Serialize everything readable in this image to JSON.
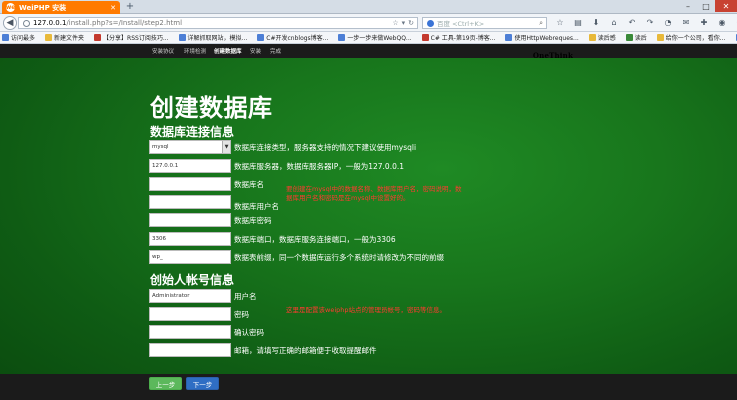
{
  "browser": {
    "tab_title": "WeiPHP 安装",
    "tab_logo": "we",
    "new_tab": "+",
    "window_controls": {
      "minimize": "–",
      "maximize": "□",
      "close": "✕"
    },
    "url_host": "127.0.0.1",
    "url_path": "/install.php?s=/Install/step2.html",
    "search_placeholder": "百度 <Ctrl+K>"
  },
  "bookmarks": [
    {
      "label": "访问最多",
      "color": "#4d7fd6"
    },
    {
      "label": "新建文件夹",
      "color": "#e8b93a"
    },
    {
      "label": "【分享】RSS订阅技巧...",
      "color": "#c43a2f"
    },
    {
      "label": "详解抓取网站，模拟...",
      "color": "#4d7fd6"
    },
    {
      "label": "C#开发cnblogs博客...",
      "color": "#4d7fd6"
    },
    {
      "label": "一步一步来做WebQQ...",
      "color": "#4d7fd6"
    },
    {
      "label": "C# 工具-第19页-博客...",
      "color": "#c43a2f"
    },
    {
      "label": "使用HttpWebreques...",
      "color": "#4d7fd6"
    },
    {
      "label": "读后感",
      "color": "#e8b93a"
    },
    {
      "label": "读后",
      "color": "#3a8a3a"
    },
    {
      "label": "给你一个公司，看你...",
      "color": "#e8b93a"
    },
    {
      "label": "WebBrowser",
      "color": "#4d7fd6"
    }
  ],
  "page_nav": {
    "items": [
      "安装协议",
      "环境检测",
      "创建数据库",
      "安装",
      "完成"
    ],
    "active": "创建数据库",
    "brand": "OneThink"
  },
  "page": {
    "title": "创建数据库",
    "db_section_title": "数据库连接信息",
    "db_fields": [
      {
        "value": "mysql",
        "help": "数据库连接类型，服务器支持的情况下建议使用mysqli",
        "type": "select",
        "arrow": "▼"
      },
      {
        "value": "127.0.0.1",
        "help": "数据库服务器，数据库服务器IP，一般为127.0.0.1"
      },
      {
        "value": "",
        "help": "数据库名"
      },
      {
        "value": "",
        "help": "数据库用户名"
      },
      {
        "value": "",
        "help": "数据库密码"
      },
      {
        "value": "3306",
        "help": "数据库端口，数据库服务连接端口，一般为3306"
      },
      {
        "value": "wp_",
        "help": "数据表前缀，同一个数据库运行多个系统时请修改为不同的前缀"
      }
    ],
    "db_note": "要创建在mysql中的数据名称、数据库用户名，密码说明，数据库用户名和密码是在mysql中设置好的。",
    "admin_section_title": "创始人帐号信息",
    "admin_fields": [
      {
        "value": "Administrator",
        "help": "用户名"
      },
      {
        "value": "",
        "help": "密码"
      },
      {
        "value": "",
        "help": "确认密码"
      },
      {
        "value": "",
        "help": "邮箱，请填写正确的邮箱便于收取提醒邮件"
      }
    ],
    "admin_note": "这里是配置该weiphp站点的管理员帐号，密码等信息。",
    "prev_button": "上一步",
    "next_button": "下一步"
  }
}
